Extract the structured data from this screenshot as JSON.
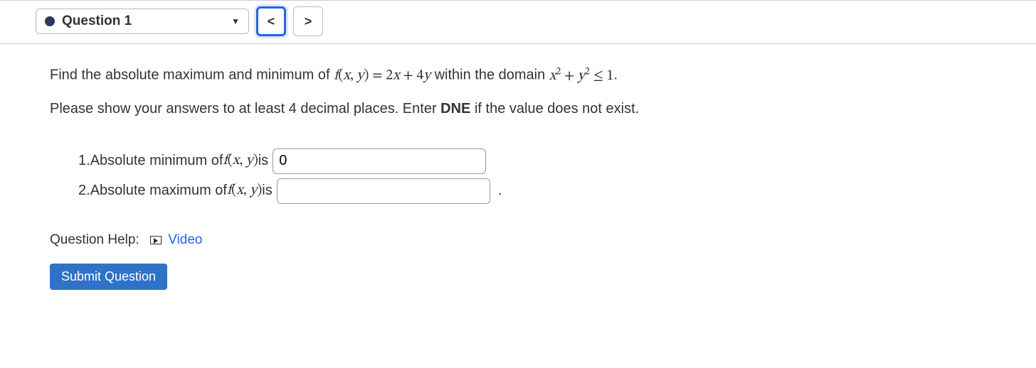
{
  "nav": {
    "question_label": "Question 1",
    "prev": "<",
    "next": ">"
  },
  "prompt": {
    "pre": "Find the absolute maximum and minimum of ",
    "fn": "f(x, y) = 2x + 4y",
    "mid": " within the domain ",
    "domain": "x² + y² ≤ 1",
    "post": "."
  },
  "instructions": {
    "pre": "Please show your answers to at least 4 decimal places. Enter ",
    "bold": "DNE",
    "post": " if the value does not exist."
  },
  "answers": {
    "item1_num": "1. ",
    "item1_text": "Absolute minimum of ",
    "item1_fn": "f(x, y)",
    "item1_is": " is ",
    "item1_value": "0",
    "item2_num": "2. ",
    "item2_text": "Absolute maximum of ",
    "item2_fn": "f(x, y)",
    "item2_is": " is ",
    "item2_value": "",
    "item2_post": "  ."
  },
  "help": {
    "label": "Question Help:",
    "video": "Video"
  },
  "submit": {
    "label": "Submit Question"
  }
}
